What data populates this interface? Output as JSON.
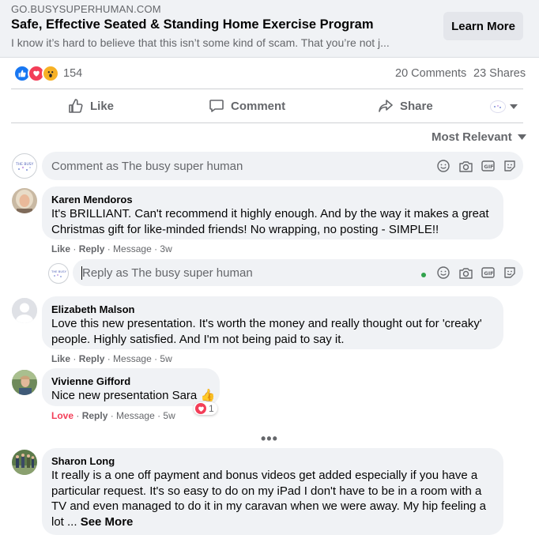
{
  "preview": {
    "domain": "GO.BUSYSUPERHUMAN.COM",
    "title": "Safe, Effective Seated & Standing Home Exercise Program",
    "description": "I know it’s hard to believe that this isn’t some kind of scam. That you’re not j...",
    "cta_label": "Learn More"
  },
  "reactions": {
    "icons": [
      "like-icon",
      "love-icon",
      "wow-icon"
    ],
    "count": "154",
    "comments": "20 Comments",
    "shares": "23 Shares"
  },
  "actions": {
    "like": "Like",
    "comment": "Comment",
    "share": "Share"
  },
  "sort": {
    "label": "Most Relevant"
  },
  "composer": {
    "placeholder": "Comment as The busy super human"
  },
  "reply_composer": {
    "placeholder": "Reply as The busy super human"
  },
  "comments": [
    {
      "author": "Karen Mendoros",
      "text": "It's BRILLIANT. Can't recommend it highly enough. And by the way it makes a great Christmas gift for like-minded friends! No wrapping, no posting - SIMPLE!!",
      "like": "Like",
      "reply": "Reply",
      "message": "Message",
      "time": "3w"
    },
    {
      "author": "Elizabeth Malson",
      "text": "Love this new presentation. It's worth the money and really thought out for 'creaky' people. Highly satisfied. And I'm not being paid to say it.",
      "like": "Like",
      "reply": "Reply",
      "message": "Message",
      "time": "5w"
    },
    {
      "author": "Vivienne Gifford",
      "text": "Nice new presentation Sara 👍",
      "like": "Love",
      "reply": "Reply",
      "message": "Message",
      "time": "5w",
      "reaction_count": "1"
    },
    {
      "author": "Sharon Long",
      "text": "It really is a one off payment and bonus videos get added especially if you have a particular request. It's so easy to do on my iPad I don't have to be in a room with a TV and even managed to do it in my caravan when we were away. My hip feeling a lot ...",
      "see_more": "See More"
    }
  ],
  "more_replies": "•••",
  "colors": {
    "accent": "#1877f2",
    "love": "#f33e58",
    "secondary_text": "#65676b",
    "bubble": "#f0f2f5"
  }
}
